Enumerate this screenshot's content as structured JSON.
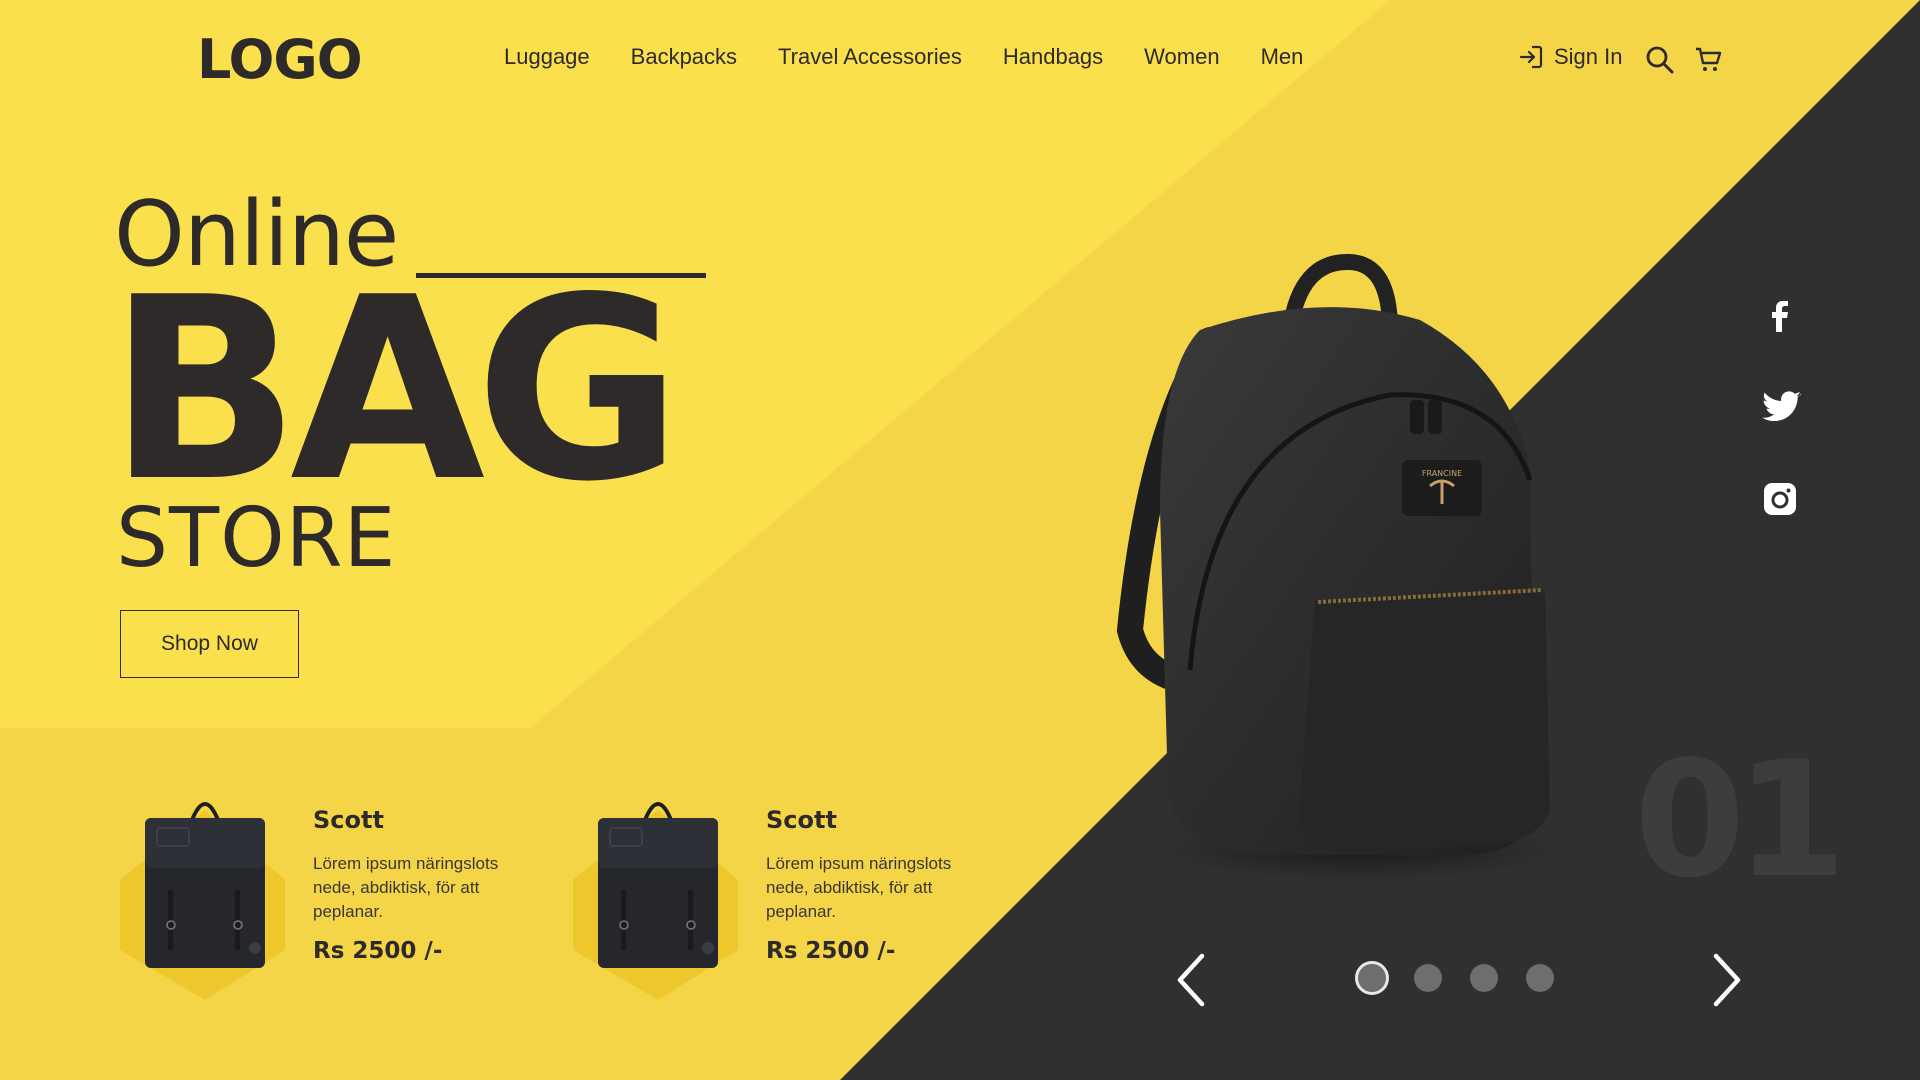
{
  "brand": {
    "logo": "LOGO"
  },
  "nav": {
    "items": [
      {
        "label": "Luggage"
      },
      {
        "label": "Backpacks"
      },
      {
        "label": "Travel Accessories"
      },
      {
        "label": "Handbags"
      },
      {
        "label": "Women"
      },
      {
        "label": "Men"
      }
    ],
    "sign_in": "Sign In"
  },
  "hero": {
    "line1": "Online",
    "line2": "BAG",
    "line3": "STORE",
    "cta": "Shop Now",
    "backpack_brand_text": "FRANCINE"
  },
  "products": [
    {
      "title": "Scott",
      "description": "Lörem ipsum näringslots nede, abdiktisk, för att peplanar.",
      "price": "Rs 2500 /-"
    },
    {
      "title": "Scott",
      "description": "Lörem ipsum näringslots nede, abdiktisk, för att peplanar.",
      "price": "Rs 2500 /-"
    }
  ],
  "slider": {
    "current": "01",
    "dots": 4,
    "active_index": 0
  },
  "social": [
    "facebook-icon",
    "twitter-icon",
    "instagram-icon"
  ],
  "colors": {
    "yellow": "#fbe04e",
    "yellow_deep": "#f5d44a",
    "dark": "#2f302f",
    "text": "#2e2a2a"
  }
}
